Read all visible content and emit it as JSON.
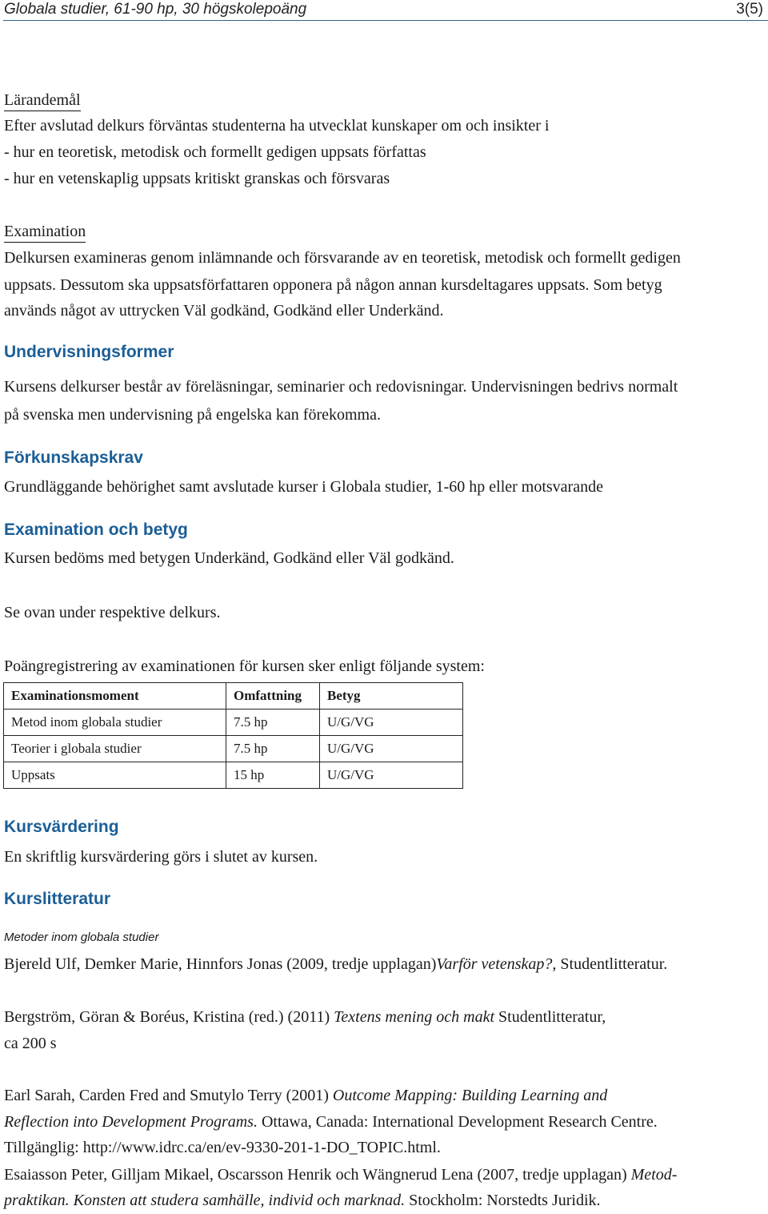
{
  "header": {
    "title": "Globala studier, 61-90 hp, 30 högskolepoäng",
    "page": "3(5)"
  },
  "larandemal": {
    "heading": "Lärandemål",
    "intro": "Efter avslutad delkurs förväntas studenterna ha utvecklat kunskaper om och insikter i",
    "items": [
      "- hur en teoretisk, metodisk och formellt gedigen uppsats författas",
      "- hur en vetenskaplig uppsats kritiskt granskas och försvaras"
    ]
  },
  "examination": {
    "heading": "Examination",
    "lines": [
      "Delkursen examineras genom inlämnande och försvarande av en teoretisk, metodisk och formellt gedigen",
      "uppsats. Dessutom ska uppsatsförfattaren opponera på någon annan kursdeltagares uppsats. Som betyg",
      "används något av uttrycken Väl godkänd, Godkänd eller Underkänd."
    ]
  },
  "undervisningsformer": {
    "heading": "Undervisningsformer",
    "lines": [
      "Kursens delkurser består av föreläsningar, seminarier och redovisningar. Undervisningen bedrivs normalt",
      "på svenska men undervisning på engelska kan förekomma."
    ]
  },
  "forkunskapskrav": {
    "heading": "Förkunskapskrav",
    "text": "Grundläggande behörighet samt avslutade kurser i Globala studier, 1-60 hp eller motsvarande"
  },
  "examination_betyg": {
    "heading": "Examination och betyg",
    "text": "Kursen bedöms med betygen Underkänd, Godkänd eller Väl godkänd.",
    "note": "Se ovan under respektive delkurs.",
    "table_intro": "Poängregistrering av examinationen för kursen sker enligt följande system:",
    "table": {
      "headers": [
        "Examinationsmoment",
        "Omfattning",
        "Betyg"
      ],
      "rows": [
        [
          "Metod inom globala studier",
          "7.5 hp",
          "U/G/VG"
        ],
        [
          "Teorier i globala studier",
          "7.5 hp",
          "U/G/VG"
        ],
        [
          "Uppsats",
          "15 hp",
          "U/G/VG"
        ]
      ]
    }
  },
  "kursvardering": {
    "heading": "Kursvärdering",
    "text": "En skriftlig kursvärdering görs i slutet av kursen."
  },
  "kurslitteratur": {
    "heading": "Kurslitteratur",
    "subheading": "Metoder inom globala studier",
    "refs": [
      {
        "before": "Bjereld Ulf, Demker Marie, Hinnfors Jonas (2009, tredje upplagan)",
        "title": "Varför vetenskap?",
        "after": ", Studentlitteratur."
      },
      {
        "before": "Bergström, Göran & Boréus, Kristina (red.) (2011) ",
        "title": "Textens mening och makt",
        "after": " Studentlitteratur,",
        "line2": "ca 200 s"
      },
      {
        "before": "Earl Sarah, Carden Fred and Smutylo Terry (2001) ",
        "title_line1": "Outcome Mapping: Building Learning and",
        "title_line2": "Reflection into Development Programs.",
        "after": " Ottawa, Canada: International Development Research Centre.",
        "line3": "Tillgänglig: http://www.idrc.ca/en/ev-9330-201-1-DO_TOPIC.html."
      },
      {
        "before": "Esaiasson Peter, Gilljam Mikael, Oscarsson Henrik och Wängnerud Lena (2007, tredje upplagan) ",
        "title_line1": "Metod-",
        "title_line2": "praktikan. Konsten att studera samhälle, individ och marknad.",
        "after": " Stockholm: Norstedts Juridik."
      }
    ]
  },
  "colors": {
    "heading_blue": "#1b5e96",
    "header_rule": "#2f5f8a",
    "text": "#1a1a1a"
  }
}
